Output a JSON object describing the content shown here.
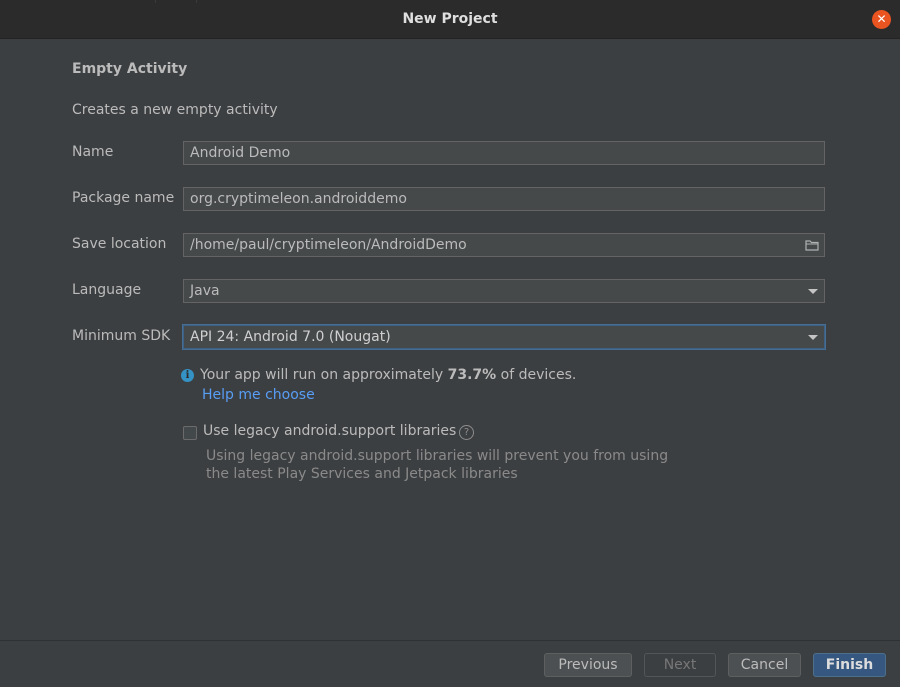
{
  "window": {
    "title": "New Project"
  },
  "form": {
    "heading": "Empty Activity",
    "description": "Creates a new empty activity",
    "name": {
      "label": "Name",
      "value": "Android Demo"
    },
    "package_name": {
      "label": "Package name",
      "value": "org.cryptimeleon.androiddemo"
    },
    "save_location": {
      "label": "Save location",
      "value": "/home/paul/cryptimeleon/AndroidDemo"
    },
    "language": {
      "label": "Language",
      "value": "Java"
    },
    "minimum_sdk": {
      "label": "Minimum SDK",
      "value": "API 24: Android 7.0 (Nougat)"
    }
  },
  "info": {
    "text_before": "Your app will run on approximately ",
    "percent": "73.7%",
    "text_after": " of devices.",
    "help_link": "Help me choose"
  },
  "legacy": {
    "label": "Use legacy android.support libraries",
    "checked": false,
    "description_line1": "Using legacy android.support libraries will prevent you from using",
    "description_line2": "the latest Play Services and Jetpack libraries"
  },
  "buttons": {
    "previous": "Previous",
    "next": "Next",
    "cancel": "Cancel",
    "finish": "Finish"
  },
  "icons": {
    "close": "close-icon",
    "folder": "folder-icon",
    "info": "info-icon",
    "help": "question-icon",
    "dropdown": "chevron-down-icon"
  },
  "colors": {
    "background": "#3c3f41",
    "titlebar": "#2b2b2b",
    "close_button": "#e95420",
    "link": "#589df6",
    "primary_button": "#365880",
    "focus_border": "#466d94"
  }
}
